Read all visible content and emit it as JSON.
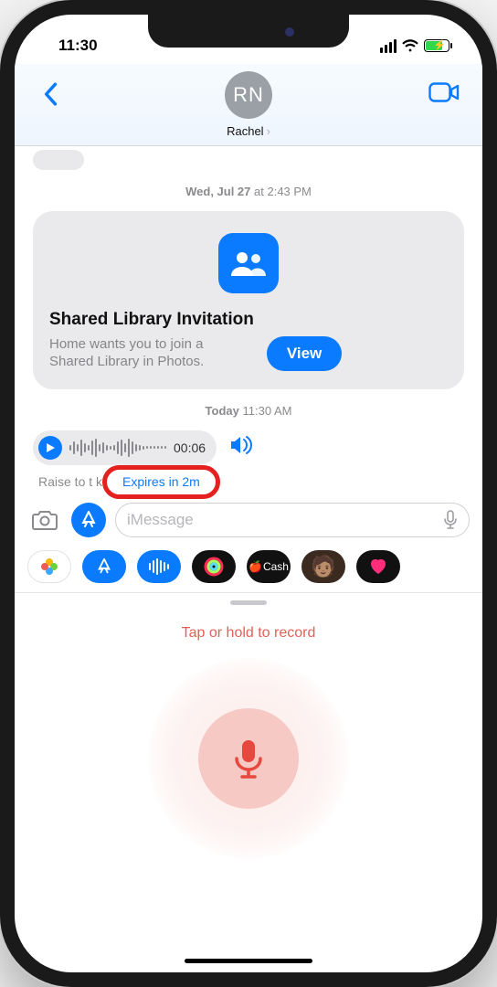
{
  "status": {
    "time": "11:30"
  },
  "header": {
    "avatar_initials": "RN",
    "contact_name": "Rachel"
  },
  "conversation": {
    "timestamp1_prefix": "Wed, Jul 27",
    "timestamp1_suffix": " at 2:43 PM",
    "timestamp2_prefix": "Today",
    "timestamp2_suffix": " 11:30 AM"
  },
  "invitation": {
    "title": "Shared Library Invitation",
    "subtitle": "Home wants you to join a Shared Library in Photos.",
    "button": "View"
  },
  "audio": {
    "duration": "00:06",
    "raise_hint": "Raise to t   k",
    "expires": "Expires in 2m"
  },
  "compose": {
    "placeholder": "iMessage"
  },
  "appstrip": {
    "cash_label": "Cash"
  },
  "record": {
    "label": "Tap or hold to record"
  }
}
